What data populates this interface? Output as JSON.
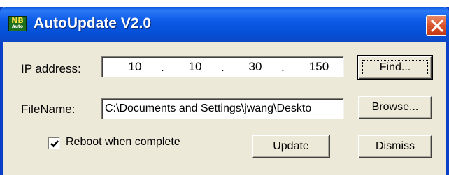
{
  "window": {
    "title": "AutoUpdate V2.0",
    "icon": {
      "top": "NB",
      "bottom": "Auto"
    }
  },
  "form": {
    "ip_label": "IP address:",
    "ip_octets": [
      "10",
      "10",
      "30",
      "150"
    ],
    "ip_separator": ".",
    "filename_label": "FileName:",
    "filename_value": "C:\\Documents and Settings\\jwang\\Deskto",
    "reboot_label": "Reboot when complete",
    "reboot_checked": true
  },
  "buttons": {
    "find": "Find...",
    "browse": "Browse...",
    "update": "Update",
    "dismiss": "Dismiss"
  },
  "colors": {
    "titlebar": "#0550d8",
    "window_face": "#ece9d8",
    "close": "#d9542c"
  },
  "icons": {
    "close": "close-x-icon",
    "check": "checkmark-icon",
    "app": "app-logo-icon"
  }
}
